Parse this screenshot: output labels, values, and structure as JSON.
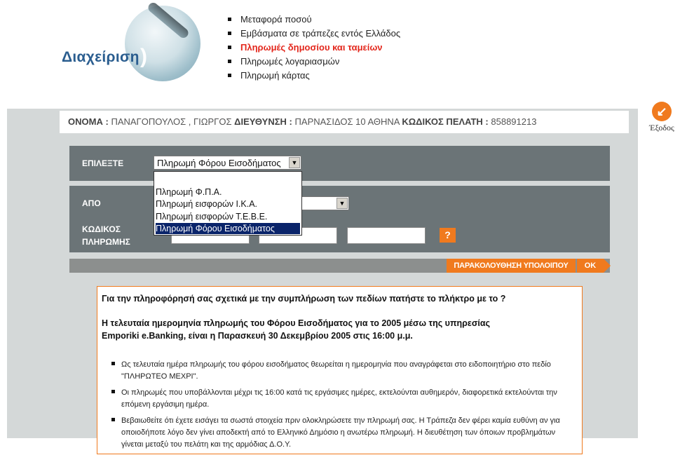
{
  "brand": {
    "logo_text": "Διαχείριση",
    "logo_paren": ")"
  },
  "top_menu": [
    {
      "label": "Μεταφορά ποσού",
      "active": false
    },
    {
      "label": "Εμβάσματα σε τράπεζες εντός Ελλάδος",
      "active": false
    },
    {
      "label": "Πληρωμές δημοσίου και ταμείων",
      "active": true
    },
    {
      "label": "Πληρωμές λογαριασμών",
      "active": false
    },
    {
      "label": "Πληρωμή κάρτας",
      "active": false
    }
  ],
  "customer": {
    "name_label": "ΟΝΟΜΑ",
    "name_value": "ΠΑΝΑΓΟΠΟΥΛΟΣ , ΓΙΩΡΓΟΣ",
    "address_label": "ΔΙΕΥΘΥΝΣΗ",
    "address_value": "ΠΑΡΝΑΣΙΔΟΣ 10 ΑΘΗΝΑ",
    "code_label": "ΚΩΔΙΚΟΣ ΠΕΛΑΤΗ",
    "code_value": "858891213",
    "sep": ":"
  },
  "logout": {
    "label": "Έξοδος",
    "icon": "exit-arrow-icon",
    "glyph": "↙"
  },
  "form": {
    "select_label": "ΕΠΙΛΕΞΤΕ",
    "select_value": "Πληρωμή Φόρου Εισοδήματος",
    "dropdown_options": [
      "Πληρωμή Φ.Π.Α.",
      "Πληρωμή εισφορών Ι.Κ.Α.",
      "Πληρωμή εισφορών Τ.Ε.Β.Ε.",
      "Πληρωμή Φόρου Εισοδήματος"
    ],
    "selected_option_index": 3,
    "from_label": "ΑΠΟ",
    "payment_code_label_1": "ΚΩΔΙΚΟΣ",
    "payment_code_label_2": "ΠΛΗΡΩΜΗΣ",
    "help_glyph": "?",
    "arrow_glyph": "▼"
  },
  "actions": {
    "track_balance": "ΠΑΡΑΚΟΛΟΥΘΗΣΗ ΥΠΟΛΟΙΠΟΥ",
    "ok": "OK"
  },
  "info": {
    "p1": "Για την πληροφόρησή σας σχετικά με την συμπλήρωση των πεδίων πατήστε το πλήκτρο με το ?",
    "p2_line1": "Η τελευταία ημερομηνία πληρωμής του Φόρου Εισοδήματος για το 2005 μέσω της υπηρεσίας",
    "p2_line2": "Emporiki e.Banking, είναι η Παρασκευή 30 Δεκεμβρίου 2005 στις 16:00 μ.μ.",
    "notes": [
      "Ως τελευταία ημέρα πληρωμής του φόρου εισοδήματος θεωρείται η ημερομηνία που αναγράφεται στο ειδοποιητήριο στο πεδίο \"ΠΛΗΡΩΤΕΟ ΜΕΧΡΙ\".",
      "Οι πληρωμές που υποβάλλονται μέχρι τις 16:00 κατά τις εργάσιμες ημέρες, εκτελούνται αυθημερόν, διαφορετικά εκτελούνται την επόμενη εργάσιμη ημέρα.",
      "Βεβαιωθείτε ότι έχετε εισάγει τα σωστά στοιχεία πριν ολοκληρώσετε την πληρωμή σας. Η Τράπεζα δεν φέρει καμία ευθύνη αν για οποιοδήποτε λόγο δεν γίνει αποδεκτή από το Ελληνικό Δημόσιο η ανωτέρω πληρωμή. Η διευθέτηση των όποιων προβλημάτων γίνεται μεταξύ του πελάτη και της αρμόδιας Δ.Ο.Υ."
    ]
  },
  "colors": {
    "accent": "#f07a1e",
    "brand": "#2a5d8f",
    "active_menu": "#e3261b",
    "panel": "#6b7477",
    "page_bg": "#d4d8d8"
  }
}
